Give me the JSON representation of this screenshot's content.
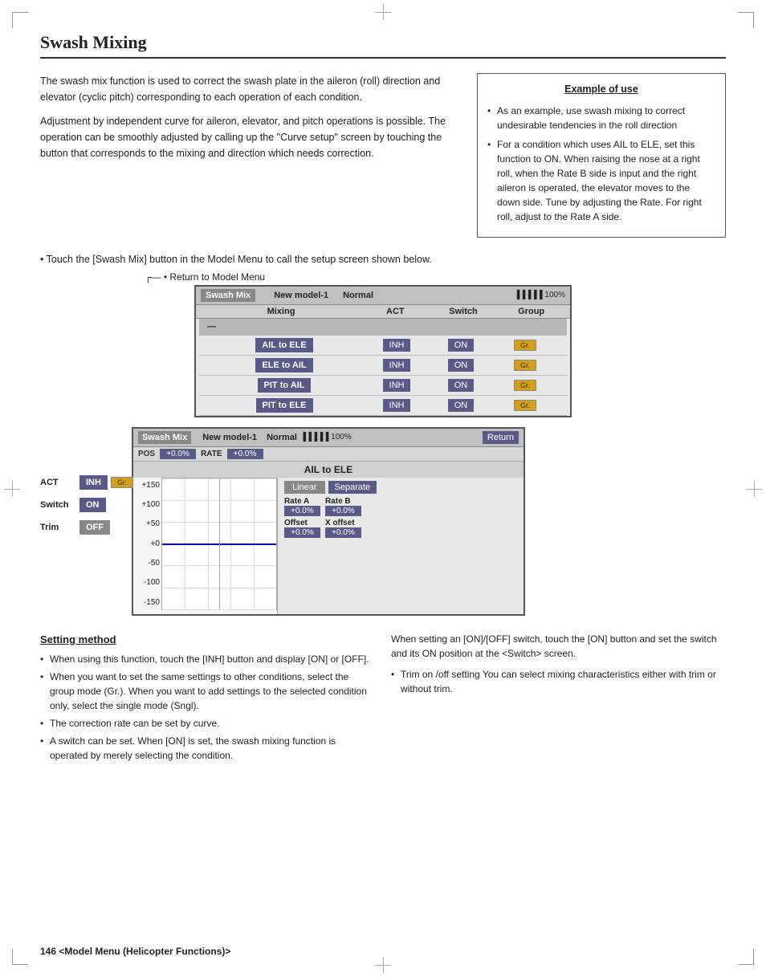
{
  "page": {
    "title": "Swash Mixing",
    "footer": "146  <Model Menu (Helicopter Functions)>"
  },
  "intro": {
    "para1": "The swash mix function is used to correct the swash plate in the aileron (roll) direction and elevator (cyclic pitch) corresponding to each operation of each condition.",
    "para2": "Adjustment by independent curve for aileron, elevator, and pitch operations is possible. The operation can be smoothly adjusted by calling up the \"Curve setup\" screen by touching the button that corresponds to the mixing and direction which needs correction."
  },
  "example": {
    "title": "Example of use",
    "items": [
      "As an example, use swash mixing to correct undesirable tendencies in the roll direction",
      "For a condition which uses AIL to ELE, set this function to ON. When raising the nose at a right roll, when the Rate B side is input and the right aileron is operated, the elevator moves to the down side. Tune by adjusting the Rate. For right roll, adjust to the Rate A side."
    ]
  },
  "touch_instruction": "Touch the [Swash Mix] button in the Model Menu to call the setup screen shown below.",
  "return_label": "Return to Model Menu",
  "screen1": {
    "header": {
      "swash_mix": "Swash Mix",
      "model_name": "New model-1",
      "normal": "Normal",
      "battery": "100%"
    },
    "columns": {
      "mixing": "Mixing",
      "act": "ACT",
      "switch_col": "Switch",
      "group": "Group"
    },
    "rows": [
      {
        "label": "AIL to ELE",
        "act": "INH",
        "switch_val": "ON",
        "group": "Gr."
      },
      {
        "label": "ELE to AIL",
        "act": "INH",
        "switch_val": "ON",
        "group": "Gr."
      },
      {
        "label": "PIT to AIL",
        "act": "INH",
        "switch_val": "ON",
        "group": "Gr."
      },
      {
        "label": "PIT to ELE",
        "act": "INH",
        "switch_val": "ON",
        "group": "Gr."
      }
    ]
  },
  "screen2": {
    "header": {
      "swash_mix": "Swash Mix",
      "model_name": "New model-1",
      "normal": "Normal",
      "battery": "100%",
      "return_btn": "Return"
    },
    "subheader": {
      "pos_label": "POS",
      "pos_val": "+0.0%",
      "rate_label": "RATE",
      "rate_val": "+0.0%"
    },
    "detail_title": "AIL to ELE",
    "act_label": "ACT",
    "act_btn": "INH",
    "switch_label": "Switch",
    "switch_btn": "ON",
    "trim_label": "Trim",
    "trim_btn": "OFF",
    "graph": {
      "labels": [
        "+150",
        "+100",
        "+50",
        "+0",
        "-50",
        "-100",
        "-150"
      ]
    },
    "right_panel": {
      "linear_btn": "Linear",
      "separate_btn": "Separate",
      "rate_a_label": "Rate A",
      "rate_a_val": "+0.0%",
      "rate_b_label": "Rate B",
      "rate_b_val": "+0.0%",
      "offset_label": "Offset",
      "offset_val": "+0.0%",
      "x_offset_label": "X offset",
      "x_offset_val": "+0.0%"
    }
  },
  "setting_method": {
    "title": "Setting method",
    "items": [
      "When using this function, touch the [INH] button and display [ON] or [OFF].",
      "When you want to set the same settings to other conditions, select the group mode (Gr.). When you want to add settings to the selected condition only, select the single mode (Sngl).",
      "The correction rate can be set by curve.",
      "A switch can be set.\nWhen [ON] is set, the swash mixing function is operated by merely selecting the condition."
    ]
  },
  "right_notes": {
    "para1": "When setting an [ON]/[OFF] switch, touch the [ON] button and set the switch and its ON position at the <Switch> screen.",
    "bullet1": "Trim on /off setting\nYou can select mixing characteristics either with trim or without trim."
  }
}
